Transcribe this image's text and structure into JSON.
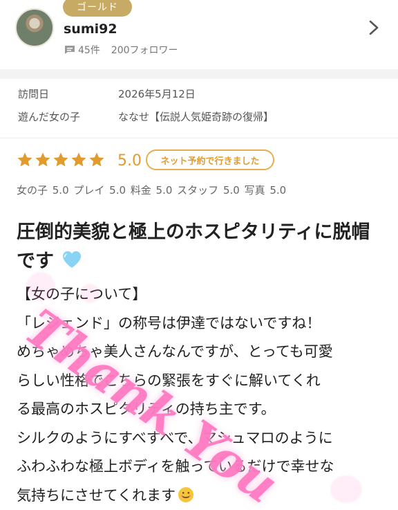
{
  "user": {
    "badge": "ゴールド",
    "username": "sumi92",
    "review_count": "45件",
    "followers": "200フォロワー"
  },
  "info": {
    "visit_label": "訪問日",
    "visit_date": "2026年5月12日",
    "girl_label": "遊んだ女の子",
    "girl_name": "ななせ【伝説人気姫奇跡の復帰】"
  },
  "rating": {
    "score": "5.0",
    "tag": "ネット予約で行きました",
    "star_count": 5,
    "subscores": "女の子 5.0 プレイ 5.0 料金 5.0 スタッフ 5.0 写真 5.0"
  },
  "review": {
    "title": "圧倒的美貌と極上のホスピタリティに脱帽です",
    "lines": [
      "【女の子について】",
      "「レジェンド」の称号は伊達ではないですね！",
      "めちゃめちゃ美人さんなんですが、とっても可愛",
      "らしい性格でこちらの緊張をすぐに解いてくれ",
      "る最高のホスピタリティの持ち主です。",
      "シルクのようにすべすべで、マシュマロのように",
      "ふわふわな極上ボディを触っているだけで幸せな",
      "気持ちにさせてくれます"
    ]
  },
  "watermark": {
    "text": "Thank You",
    "color": "#ff7ac2"
  },
  "icons": {
    "chevron": "chevron-right-icon",
    "comment": "comment-icon",
    "star": "star-icon",
    "heart": "blue-heart-icon",
    "smile": "smiling-emoji-icon"
  },
  "colors": {
    "accent": "#e29b2e",
    "badge": "#c7aa63",
    "heart": "#89d4f5"
  }
}
